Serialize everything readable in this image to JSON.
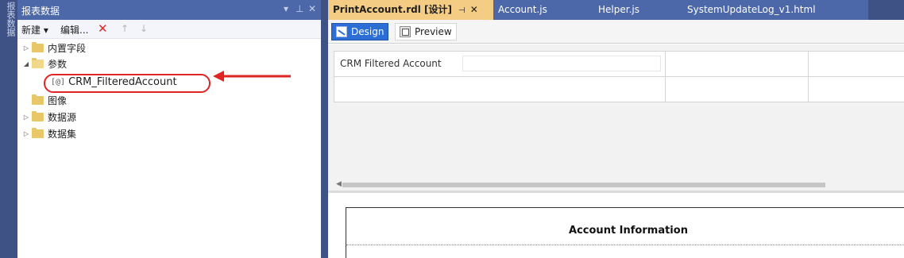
{
  "side_strip": {
    "label": "报表数据"
  },
  "panel": {
    "title": "报表数据",
    "toolbar": {
      "new": "新建 ▾",
      "edit": "编辑...",
      "delete_icon": "close-icon",
      "up_icon": "arrow-up-icon",
      "down_icon": "arrow-down-icon"
    },
    "tree": {
      "builtin_fields": "内置字段",
      "parameters": "参数",
      "parameter_item": "CRM_FilteredAccount",
      "images": "图像",
      "data_sources": "数据源",
      "datasets": "数据集"
    },
    "highlight_color": "#e02424"
  },
  "tabs": [
    {
      "label": "PrintAccount.rdl [设计]",
      "active": true
    },
    {
      "label": "Account.js"
    },
    {
      "label": "Helper.js"
    },
    {
      "label": "SystemUpdateLog_v1.html"
    }
  ],
  "mode": {
    "design": "Design",
    "preview": "Preview"
  },
  "params_panel": {
    "param_label": "CRM Filtered Account",
    "param_value": ""
  },
  "report": {
    "title": "Account Information"
  },
  "colors": {
    "accent": "#3f5285",
    "active_tab": "#f5cc84",
    "design_button": "#2c6ed6"
  }
}
